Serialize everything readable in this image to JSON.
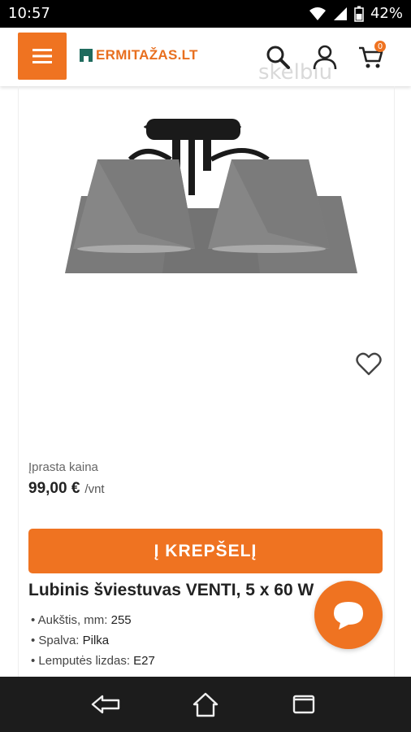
{
  "status_bar": {
    "time": "10:57",
    "battery": "42%",
    "wifi_icon": "wifi-icon",
    "signal_icon": "signal-icon",
    "battery_icon": "battery-icon"
  },
  "header": {
    "menu_icon": "hamburger-icon",
    "logo_text": "ERMITAŽAS.LT",
    "watermark": "skelbiu",
    "cart_badge": "0",
    "accent_color": "#ef7321"
  },
  "product": {
    "image": "ceiling-lamp-image",
    "favorite_icon": "heart-icon",
    "price_label": "Įprasta kaina",
    "price": "99,00 €",
    "price_unit": "/vnt",
    "add_to_cart_label": "Į KREPŠELĮ",
    "title": "Lubinis šviestuvas VENTI, 5 x 60 W",
    "specs": [
      {
        "label": "Aukštis, mm:",
        "value": "255"
      },
      {
        "label": "Spalva:",
        "value": "Pilka"
      },
      {
        "label": "Lemputės lizdas:",
        "value": "E27"
      }
    ]
  },
  "chat_icon": "chat-bubble-icon",
  "nav_bar": {
    "back_icon": "back-icon",
    "home_icon": "home-icon",
    "recents_icon": "recents-icon"
  }
}
